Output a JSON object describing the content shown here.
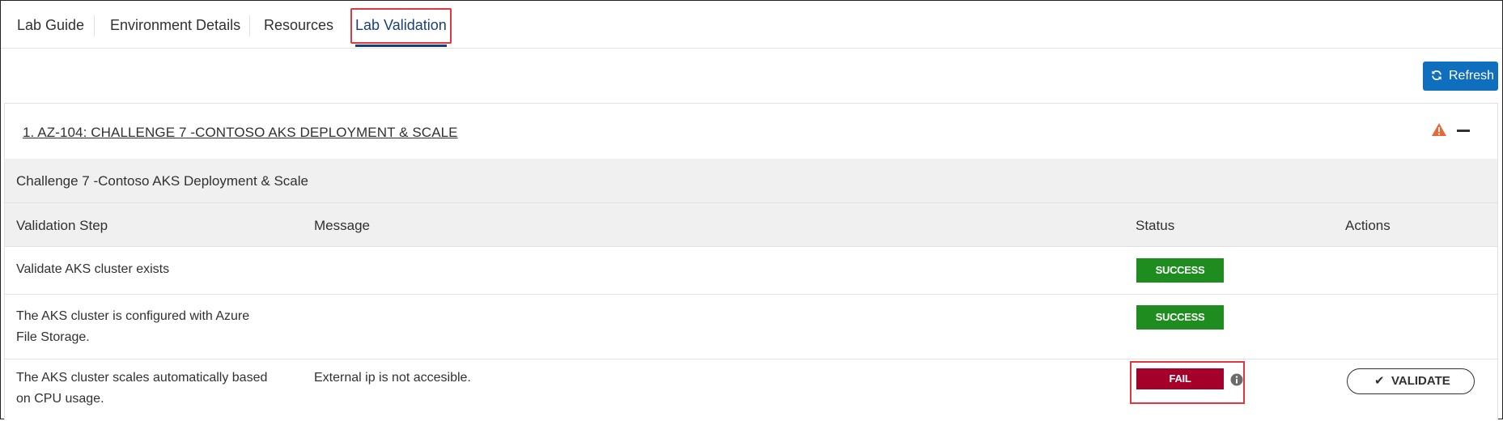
{
  "tabs": [
    {
      "label": "Lab Guide"
    },
    {
      "label": "Environment Details"
    },
    {
      "label": "Resources"
    },
    {
      "label": "Lab Validation",
      "active": true
    }
  ],
  "toolbar": {
    "refresh_label": "Refresh"
  },
  "panel": {
    "title": "1. AZ-104: CHALLENGE 7 -CONTOSO AKS DEPLOYMENT & SCALE",
    "challenge_name": "Challenge 7 -Contoso AKS Deployment & Scale",
    "columns": [
      "Validation Step",
      "Message",
      "Status",
      "Actions"
    ],
    "rows": [
      {
        "step": "Validate AKS cluster exists",
        "message": "",
        "status": "SUCCESS"
      },
      {
        "step_lines": [
          "The AKS cluster is configured with Azure",
          "File Storage."
        ],
        "message": "",
        "status": "SUCCESS"
      },
      {
        "step_lines": [
          "The AKS cluster scales automatically based",
          "on CPU usage."
        ],
        "message": "External ip is not accesible.",
        "status": "FAIL",
        "action": "VALIDATE"
      }
    ]
  },
  "colors": {
    "accent": "#1b3f7a",
    "button": "#106ebe",
    "success": "#1e8c1e",
    "fail": "#a4002a",
    "warning": "#e8683a",
    "highlight": "#e0383e"
  },
  "icons": {
    "refresh": "refresh-icon",
    "warning": "warning-icon",
    "collapse": "minus-icon",
    "info": "info-icon",
    "validate": "check-icon"
  }
}
